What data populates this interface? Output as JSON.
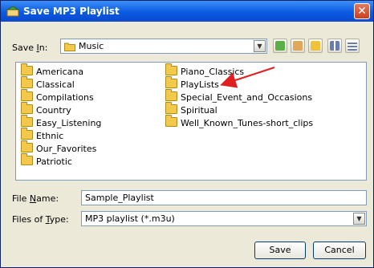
{
  "window": {
    "title": "Save MP3 Playlist",
    "close_glyph": "✕"
  },
  "save_in": {
    "label_prefix": "Save ",
    "label_accel": "I",
    "label_suffix": "n:",
    "value": "Music"
  },
  "toolbar": {
    "icons": [
      "up-folder-icon",
      "desktop-icon",
      "new-folder-icon",
      "list-view-icon",
      "details-view-icon"
    ]
  },
  "files": {
    "left_column": [
      "Americana",
      "Classical",
      "Compilations",
      "Country",
      "Easy_Listening",
      "Ethnic",
      "Our_Favorites",
      "Patriotic"
    ],
    "right_column": [
      "Piano_Classics",
      "PlayLists",
      "Special_Event_and_Occasions",
      "Spiritual",
      "Well_Known_Tunes-short_clips"
    ]
  },
  "annotation": {
    "arrow_target": "PlayLists",
    "arrow_color": "#e02020"
  },
  "file_name": {
    "label_prefix": "File ",
    "label_accel": "N",
    "label_suffix": "ame:",
    "value": "Sample_Playlist"
  },
  "file_type": {
    "label_prefix": "Files of ",
    "label_accel": "T",
    "label_suffix": "ype:",
    "value": "MP3 playlist (*.m3u)"
  },
  "buttons": {
    "save": "Save",
    "cancel": "Cancel"
  },
  "colors": {
    "titlebar": "#0a5ae0",
    "dialog_bg": "#ece9d8",
    "folder": "#f2c94a"
  }
}
